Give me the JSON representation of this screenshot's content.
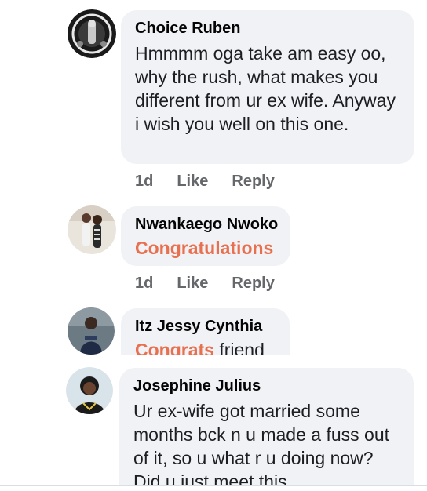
{
  "comments": [
    {
      "author": "Choice Ruben",
      "text": "Hmmmm oga take am easy oo, why the rush, what makes you different from ur ex wife. Anyway i wish you well on this one.",
      "time": "1d",
      "like_label": "Like",
      "reply_label": "Reply"
    },
    {
      "author": "Nwankaego Nwoko",
      "text": "Congratulations",
      "time": "1d",
      "like_label": "Like",
      "reply_label": "Reply"
    },
    {
      "author": "Itz Jessy Cynthia",
      "text_accent": "Congrats",
      "text_rest": " friend"
    },
    {
      "author": "Josephine Julius",
      "text": "Ur ex-wife got married some months bck n u made a fuss out of it, so u what r u doing now? Did u just meet this"
    }
  ],
  "colors": {
    "bubble": "#f0f2f5",
    "accent_text": "#e9704f",
    "meta": "#65676b"
  }
}
